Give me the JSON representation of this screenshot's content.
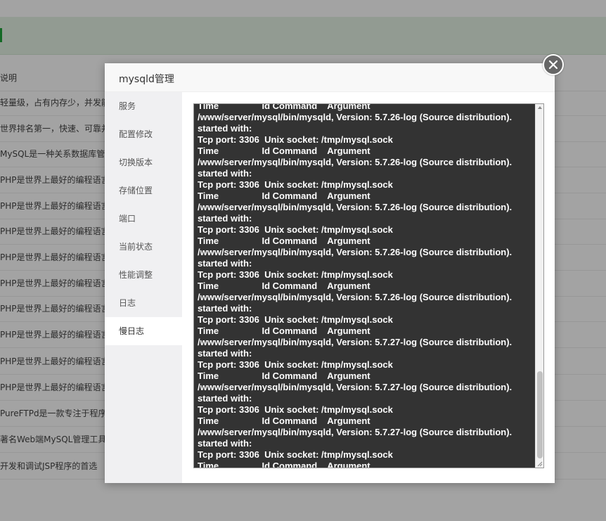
{
  "modal": {
    "title": "mysqld管理",
    "close_icon": "close-icon"
  },
  "sidebar": {
    "items": [
      {
        "label": "服务"
      },
      {
        "label": "配置修改"
      },
      {
        "label": "切换版本"
      },
      {
        "label": "存储位置"
      },
      {
        "label": "端口"
      },
      {
        "label": "当前状态"
      },
      {
        "label": "性能调整"
      },
      {
        "label": "日志"
      },
      {
        "label": "慢日志"
      }
    ],
    "active": "慢日志"
  },
  "log": {
    "text": "Time                 Id Command    Argument\n/www/server/mysql/bin/mysqld, Version: 5.7.26-log (Source distribution). started with:\nTcp port: 3306  Unix socket: /tmp/mysql.sock\nTime                 Id Command    Argument\n/www/server/mysql/bin/mysqld, Version: 5.7.26-log (Source distribution). started with:\nTcp port: 3306  Unix socket: /tmp/mysql.sock\nTime                 Id Command    Argument\n/www/server/mysql/bin/mysqld, Version: 5.7.26-log (Source distribution). started with:\nTcp port: 3306  Unix socket: /tmp/mysql.sock\nTime                 Id Command    Argument\n/www/server/mysql/bin/mysqld, Version: 5.7.26-log (Source distribution). started with:\nTcp port: 3306  Unix socket: /tmp/mysql.sock\nTime                 Id Command    Argument\n/www/server/mysql/bin/mysqld, Version: 5.7.26-log (Source distribution). started with:\nTcp port: 3306  Unix socket: /tmp/mysql.sock\nTime                 Id Command    Argument\n/www/server/mysql/bin/mysqld, Version: 5.7.27-log (Source distribution). started with:\nTcp port: 3306  Unix socket: /tmp/mysql.sock\nTime                 Id Command    Argument\n/www/server/mysql/bin/mysqld, Version: 5.7.27-log (Source distribution). started with:\nTcp port: 3306  Unix socket: /tmp/mysql.sock\nTime                 Id Command    Argument\n/www/server/mysql/bin/mysqld, Version: 5.7.27-log (Source distribution). started with:\nTcp port: 3306  Unix socket: /tmp/mysql.sock\nTime                 Id Command    Argument"
  },
  "background": {
    "rows": [
      "说明",
      "轻量级，占有内存少，并发能力",
      "世界排名第一，快速、可靠并且",
      "MySQL是一种关系数据库管理",
      "PHP是世界上最好的编程语言",
      "PHP是世界上最好的编程语言",
      "PHP是世界上最好的编程语言",
      "PHP是世界上最好的编程语言",
      "PHP是世界上最好的编程语言",
      "PHP是世界上最好的编程语言",
      "PHP是世界上最好的编程语言",
      "PHP是世界上最好的编程语言",
      "PHP是世界上最好的编程语言",
      "PureFTPd是一款专注于程序健",
      "著名Web端MySQL管理工具",
      "开发和调试JSP程序的首选"
    ]
  },
  "colors": {
    "accent": "#20a53a",
    "log_background": "#333333",
    "log_text": "#ffffff",
    "sidebar_background": "#f0f0f2"
  }
}
